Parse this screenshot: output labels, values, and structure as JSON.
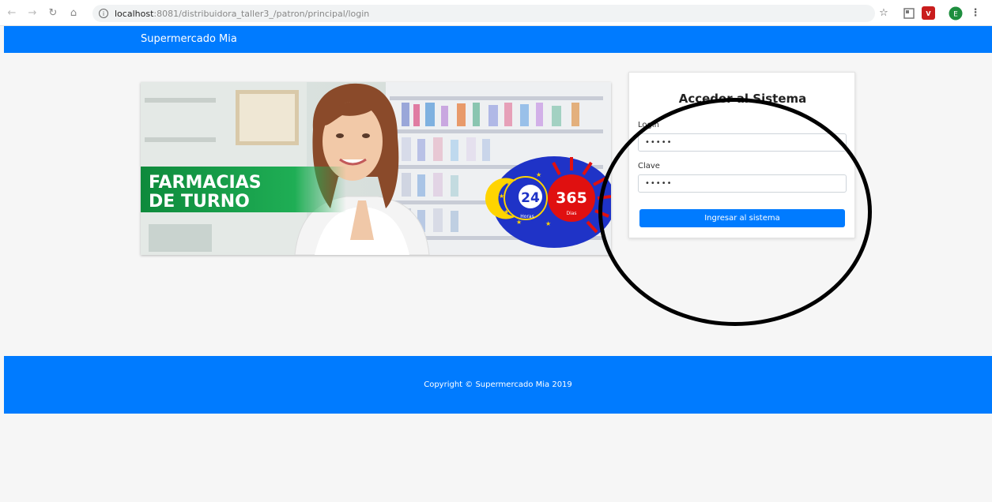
{
  "browser": {
    "url_host": "localhost",
    "url_path": ":8081/distribuidora_taller3_/patron/principal/login",
    "profile_initial": "E"
  },
  "navbar": {
    "brand": "Supermercado Mia"
  },
  "banner": {
    "line1": "FARMACIAS",
    "line2": "DE TURNO",
    "badge_24": "24",
    "badge_24_sub": "Horas",
    "badge_365": "365",
    "badge_365_sub": "Dias"
  },
  "login": {
    "title": "Acceder al Sistema",
    "login_label": "Login",
    "login_value": "•••••",
    "clave_label": "Clave",
    "clave_value": "•••••",
    "submit_label": "Ingresar al sistema"
  },
  "footer": {
    "copyright": "Copyright © Supermercado Mia 2019"
  },
  "colors": {
    "primary": "#007bff",
    "banner_green": "#1b9e4b",
    "badge_blue": "#1f33c7",
    "badge_red": "#e01010"
  }
}
